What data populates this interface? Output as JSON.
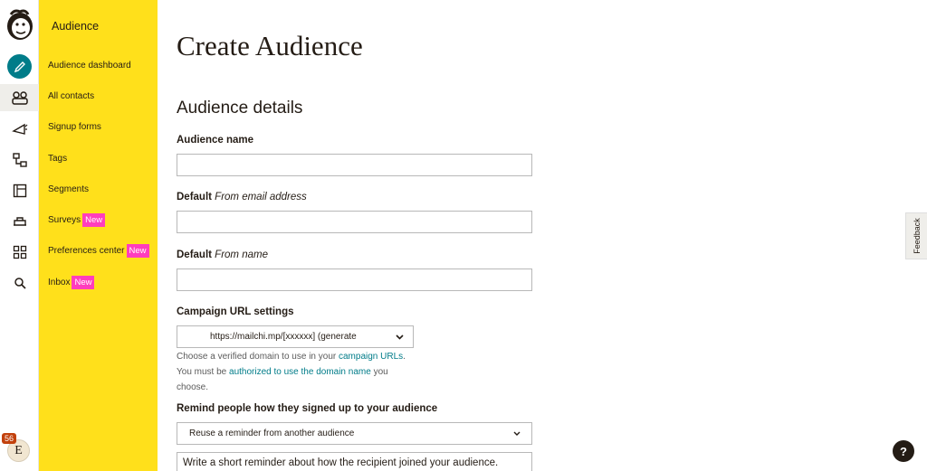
{
  "sidebar": {
    "title": "Audience",
    "items": [
      {
        "label": "Audience dashboard"
      },
      {
        "label": "All contacts"
      },
      {
        "label": "Signup forms"
      },
      {
        "label": "Tags"
      },
      {
        "label": "Segments"
      },
      {
        "label": "Surveys",
        "badge": "New"
      },
      {
        "label": "Preferences center",
        "badge": "New"
      },
      {
        "label": "Inbox",
        "badge": "New"
      }
    ]
  },
  "rail": {
    "notification_count": "56",
    "avatar_initial": "E",
    "icons": [
      "freddie-logo-icon",
      "create-pencil-icon",
      "audience-icon",
      "campaigns-megaphone-icon",
      "automations-icon",
      "website-icon",
      "content-studio-icon",
      "integrations-grid-icon",
      "search-icon"
    ]
  },
  "page": {
    "title": "Create Audience",
    "section_title": "Audience details"
  },
  "form": {
    "audience_name_label": "Audience name",
    "audience_name_value": "",
    "from_email_label_prefix": "Default ",
    "from_email_label_em": "From email address",
    "from_email_value": "",
    "from_name_label_prefix": "Default ",
    "from_name_label_em": "From name",
    "from_name_value": "",
    "campaign_url_label": "Campaign URL settings",
    "campaign_url_selected": "https://mailchi.mp/[xxxxxx] (generate",
    "help_text_1": "Choose a verified domain to use in your ",
    "help_link_1": "campaign URLs",
    "help_text_2": ". You must be ",
    "help_link_2": "authorized to use the domain name",
    "help_text_3": " you choose.",
    "remind_label": "Remind people how they signed up to your audience",
    "remind_selected": "Reuse a reminder from another audience",
    "reminder_text_placeholder": "Write a short reminder about how the recipient joined your audience."
  },
  "feedback_label": "Feedback",
  "help_button_label": "?",
  "colors": {
    "sidebar_bg": "#ffe01b",
    "accent_teal": "#007c89",
    "new_badge": "#ff3dbd",
    "text_dark": "#241c15"
  }
}
